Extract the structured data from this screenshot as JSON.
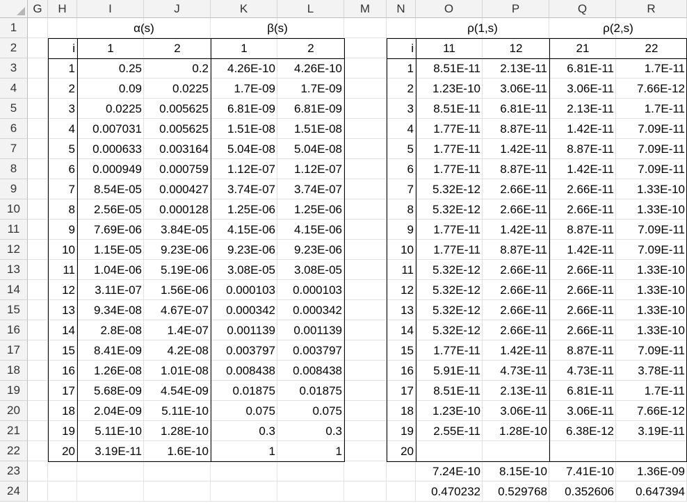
{
  "columns": [
    "G",
    "H",
    "I",
    "J",
    "K",
    "L",
    "M",
    "N",
    "O",
    "P",
    "Q",
    "R"
  ],
  "rows": [
    "1",
    "2",
    "3",
    "4",
    "5",
    "6",
    "7",
    "8",
    "9",
    "10",
    "11",
    "12",
    "13",
    "14",
    "15",
    "16",
    "17",
    "18",
    "19",
    "20",
    "21",
    "22",
    "23",
    "24"
  ],
  "left": {
    "group_headers": {
      "alpha": "α(s)",
      "beta": "β(s)"
    },
    "sub_headers": [
      "i",
      "1",
      "2",
      "1",
      "2"
    ],
    "rows": [
      [
        "1",
        "0.25",
        "0.2",
        "4.26E-10",
        "4.26E-10"
      ],
      [
        "2",
        "0.09",
        "0.0225",
        "1.7E-09",
        "1.7E-09"
      ],
      [
        "3",
        "0.0225",
        "0.005625",
        "6.81E-09",
        "6.81E-09"
      ],
      [
        "4",
        "0.007031",
        "0.005625",
        "1.51E-08",
        "1.51E-08"
      ],
      [
        "5",
        "0.000633",
        "0.003164",
        "5.04E-08",
        "5.04E-08"
      ],
      [
        "6",
        "0.000949",
        "0.000759",
        "1.12E-07",
        "1.12E-07"
      ],
      [
        "7",
        "8.54E-05",
        "0.000427",
        "3.74E-07",
        "3.74E-07"
      ],
      [
        "8",
        "2.56E-05",
        "0.000128",
        "1.25E-06",
        "1.25E-06"
      ],
      [
        "9",
        "7.69E-06",
        "3.84E-05",
        "4.15E-06",
        "4.15E-06"
      ],
      [
        "10",
        "1.15E-05",
        "9.23E-06",
        "9.23E-06",
        "9.23E-06"
      ],
      [
        "11",
        "1.04E-06",
        "5.19E-06",
        "3.08E-05",
        "3.08E-05"
      ],
      [
        "12",
        "3.11E-07",
        "1.56E-06",
        "0.000103",
        "0.000103"
      ],
      [
        "13",
        "9.34E-08",
        "4.67E-07",
        "0.000342",
        "0.000342"
      ],
      [
        "14",
        "2.8E-08",
        "1.4E-07",
        "0.001139",
        "0.001139"
      ],
      [
        "15",
        "8.41E-09",
        "4.2E-08",
        "0.003797",
        "0.003797"
      ],
      [
        "16",
        "1.26E-08",
        "1.01E-08",
        "0.008438",
        "0.008438"
      ],
      [
        "17",
        "5.68E-09",
        "4.54E-09",
        "0.01875",
        "0.01875"
      ],
      [
        "18",
        "2.04E-09",
        "5.11E-10",
        "0.075",
        "0.075"
      ],
      [
        "19",
        "5.11E-10",
        "1.28E-10",
        "0.3",
        "0.3"
      ],
      [
        "20",
        "3.19E-11",
        "1.6E-10",
        "1",
        "1"
      ]
    ]
  },
  "right": {
    "group_headers": {
      "rho1": "ρ(1,s)",
      "rho2": "ρ(2,s)"
    },
    "sub_headers": [
      "i",
      "11",
      "12",
      "21",
      "22"
    ],
    "rows": [
      [
        "1",
        "8.51E-11",
        "2.13E-11",
        "6.81E-11",
        "1.7E-11"
      ],
      [
        "2",
        "1.23E-10",
        "3.06E-11",
        "3.06E-11",
        "7.66E-12"
      ],
      [
        "3",
        "8.51E-11",
        "6.81E-11",
        "2.13E-11",
        "1.7E-11"
      ],
      [
        "4",
        "1.77E-11",
        "8.87E-11",
        "1.42E-11",
        "7.09E-11"
      ],
      [
        "5",
        "1.77E-11",
        "1.42E-11",
        "8.87E-11",
        "7.09E-11"
      ],
      [
        "6",
        "1.77E-11",
        "8.87E-11",
        "1.42E-11",
        "7.09E-11"
      ],
      [
        "7",
        "5.32E-12",
        "2.66E-11",
        "2.66E-11",
        "1.33E-10"
      ],
      [
        "8",
        "5.32E-12",
        "2.66E-11",
        "2.66E-11",
        "1.33E-10"
      ],
      [
        "9",
        "1.77E-11",
        "1.42E-11",
        "8.87E-11",
        "7.09E-11"
      ],
      [
        "10",
        "1.77E-11",
        "8.87E-11",
        "1.42E-11",
        "7.09E-11"
      ],
      [
        "11",
        "5.32E-12",
        "2.66E-11",
        "2.66E-11",
        "1.33E-10"
      ],
      [
        "12",
        "5.32E-12",
        "2.66E-11",
        "2.66E-11",
        "1.33E-10"
      ],
      [
        "13",
        "5.32E-12",
        "2.66E-11",
        "2.66E-11",
        "1.33E-10"
      ],
      [
        "14",
        "5.32E-12",
        "2.66E-11",
        "2.66E-11",
        "1.33E-10"
      ],
      [
        "15",
        "1.77E-11",
        "1.42E-11",
        "8.87E-11",
        "7.09E-11"
      ],
      [
        "16",
        "5.91E-11",
        "4.73E-11",
        "4.73E-11",
        "3.78E-11"
      ],
      [
        "17",
        "8.51E-11",
        "2.13E-11",
        "6.81E-11",
        "1.7E-11"
      ],
      [
        "18",
        "1.23E-10",
        "3.06E-11",
        "3.06E-11",
        "7.66E-12"
      ],
      [
        "19",
        "2.55E-11",
        "1.28E-10",
        "6.38E-12",
        "3.19E-11"
      ],
      [
        "20",
        "",
        "",
        "",
        ""
      ]
    ],
    "sums": [
      "7.24E-10",
      "8.15E-10",
      "7.41E-10",
      "1.36E-09"
    ],
    "ratios": [
      "0.470232",
      "0.529768",
      "0.352606",
      "0.647394"
    ]
  },
  "colors": {
    "header_bg": "#f3f3f3",
    "gridline": "#e1e1e1",
    "border": "#000000"
  }
}
